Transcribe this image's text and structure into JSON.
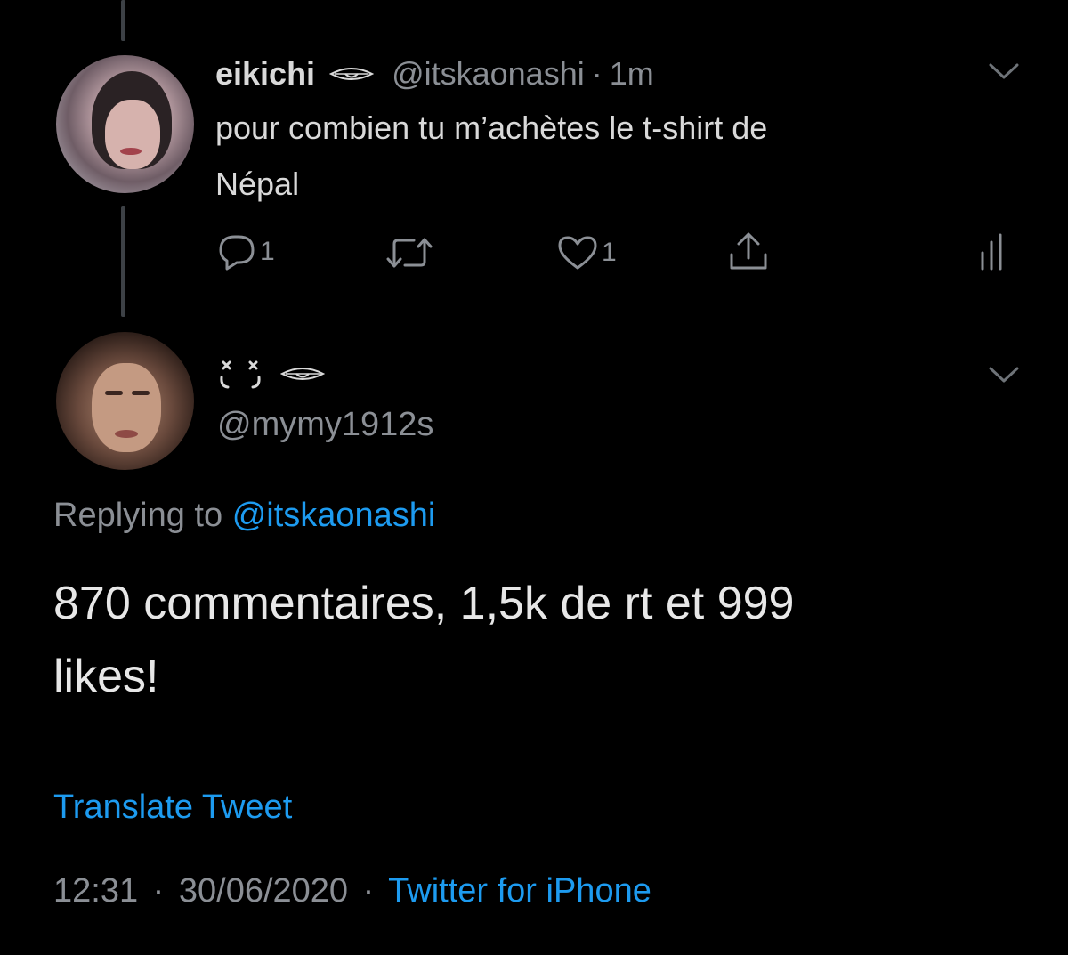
{
  "tweet1": {
    "display_name": "eikichi",
    "handle": "@itskaonashi",
    "separator": "·",
    "time": "1m",
    "text_line1": "pour combien tu m’achètes le t-shirt de",
    "text_line2": "Népal",
    "reply_count": "1",
    "like_count": "1"
  },
  "tweet2": {
    "display_name_glyphs": "ˣ ˣ",
    "handle": "@mymy1912s",
    "replying_prefix": "Replying to",
    "replying_handle": "@itskaonashi",
    "text_line1": "870 commentaires, 1,5k de rt et 999",
    "text_line2": "likes!",
    "translate_label": "Translate Tweet",
    "time": "12:31",
    "separator1": "·",
    "date": "30/06/2020",
    "separator2": "·",
    "source": "Twitter for iPhone"
  },
  "colors": {
    "background": "#000000",
    "text": "#d9d9d9",
    "muted": "#8b8f95",
    "accent": "#1d9bf0"
  },
  "icons": {
    "eye": "eye-icon",
    "chevron": "chevron-down-icon",
    "reply": "reply-icon",
    "retweet": "retweet-icon",
    "like": "heart-icon",
    "share": "share-icon",
    "analytics": "analytics-icon"
  }
}
